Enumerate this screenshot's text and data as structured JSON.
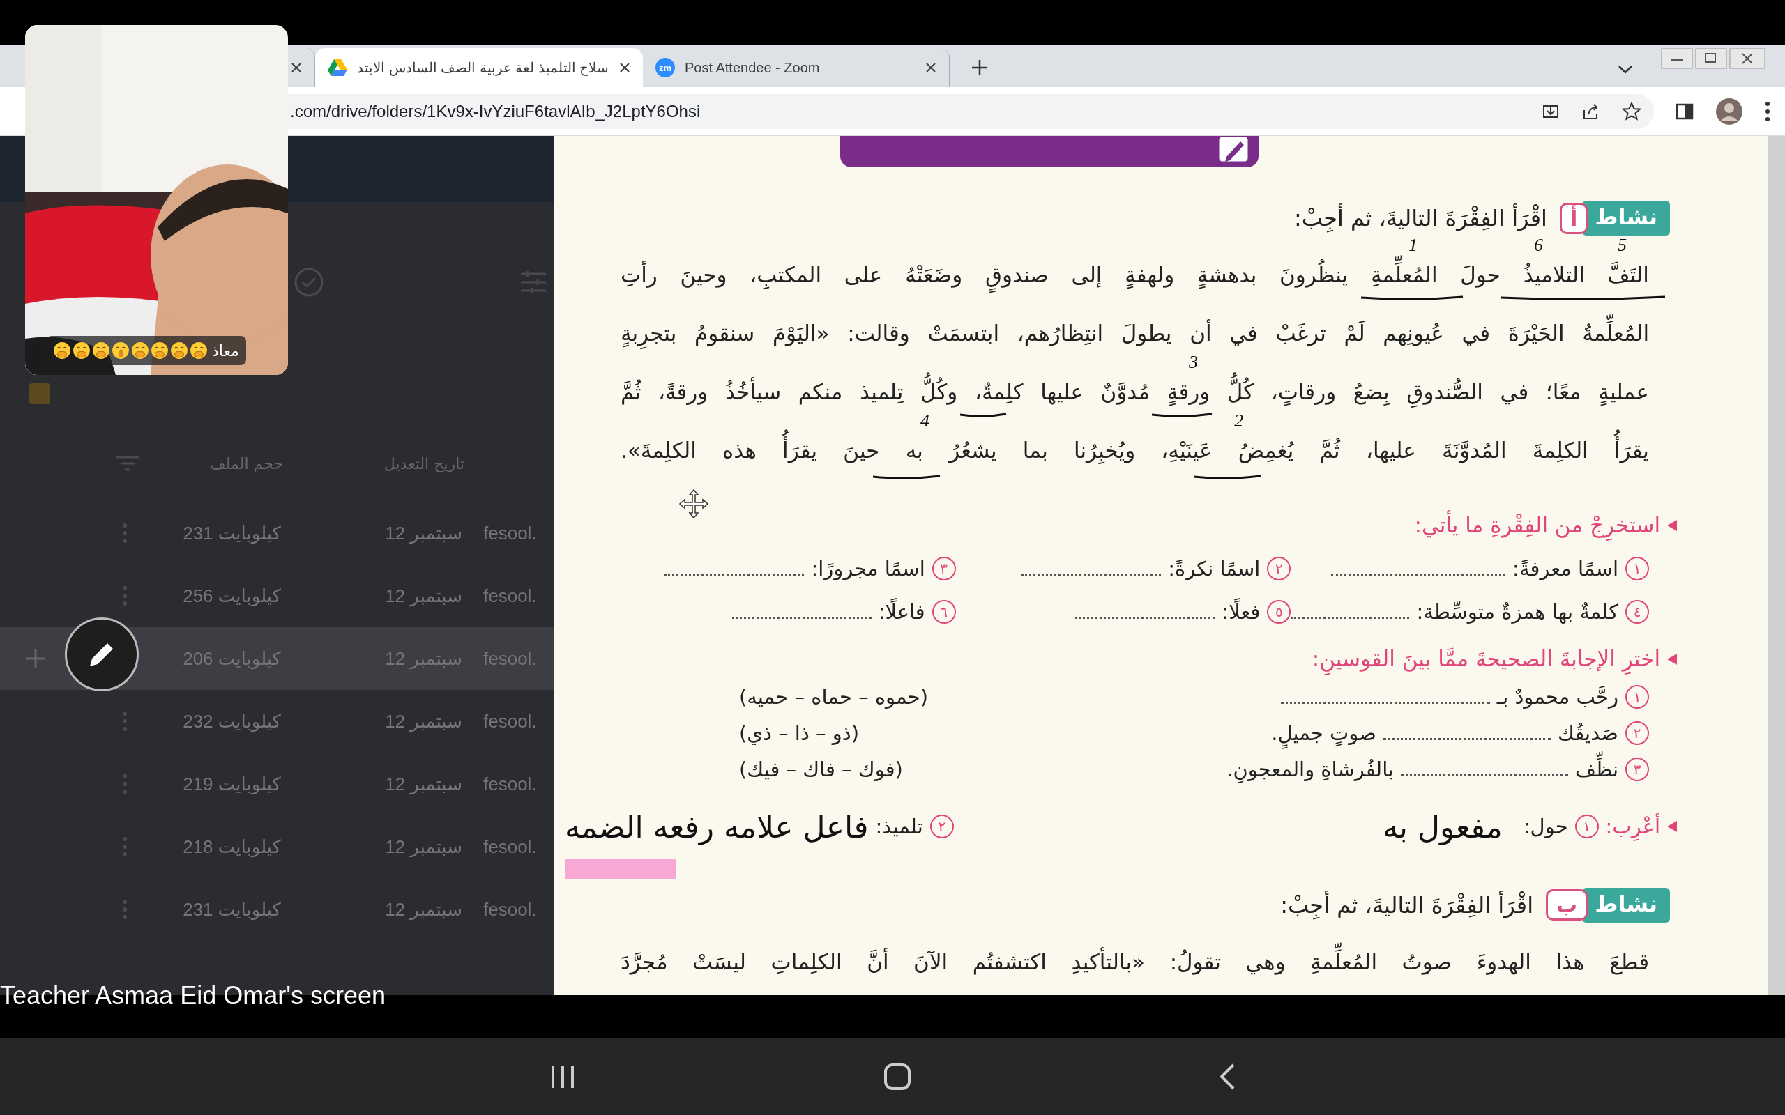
{
  "browser": {
    "first_tab": {
      "kind": "partial",
      "selected": false
    },
    "second_tab": {
      "kind": "drive",
      "title": "سلاح التلميذ لغة عربية الصف السادس الابتد",
      "selected": true
    },
    "third_tab": {
      "kind": "zoom",
      "favicon": "zm",
      "title": "Post Attendee - Zoom",
      "selected": false
    },
    "address": ".com/drive/folders/1Kv9x-IvYziuF6tavlAIb_J2LptY6Ohsi"
  },
  "drive": {
    "columns": [
      "تاريخ التعديل",
      "حجم الملف"
    ],
    "files": [
      {
        "name": "fesool.",
        "modified": "12 سبتمبر",
        "size": "231 كيلوبايت",
        "selected": false
      },
      {
        "name": "fesool.",
        "modified": "12 سبتمبر",
        "size": "256 كيلوبايت",
        "selected": false
      },
      {
        "name": "fesool.",
        "modified": "12 سبتمبر",
        "size": "206 كيلوبايت",
        "selected": true
      },
      {
        "name": "fesool.",
        "modified": "12 سبتمبر",
        "size": "232 كيلوبايت",
        "selected": false
      },
      {
        "name": "fesool.",
        "modified": "12 سبتمبر",
        "size": "219 كيلوبايت",
        "selected": false
      },
      {
        "name": "fesool.",
        "modified": "12 سبتمبر",
        "size": "218 كيلوبايت",
        "selected": false
      },
      {
        "name": "fesool.",
        "modified": "12 سبتمبر",
        "size": "231 كيلوبايت",
        "selected": false
      }
    ]
  },
  "video_tile": {
    "name": "معاذ",
    "reactions": [
      {
        "kind": "hand-over-mouth"
      },
      {
        "kind": "hand-over-mouth"
      },
      {
        "kind": "hand-over-mouth"
      },
      {
        "kind": "shush"
      },
      {
        "kind": "yawn"
      },
      {
        "kind": "yawn"
      },
      {
        "kind": "yawn"
      },
      {
        "kind": "yawn"
      }
    ]
  },
  "document": {
    "activity_a": {
      "badge": "نشاط",
      "letter": "أ",
      "instruction": "اقْرَأ الفِقْرَةَ التاليةَ، ثم أجِبْ:",
      "lines": [
        "التَفَّ التلاميذُ حولَ المُعلِّمةِ ينظُرونَ بدهشةٍ ولهفةٍ إلى صندوقٍ وضَعَتْهُ على المكتبِ، وحينَ رأتِ",
        "المُعلِّمةُ الحَيْرَةَ في عُيونِهم لَمْ ترغَبْ في أن يطولَ انتِظارُهم، ابتسمَتْ وقالت: «اليَوْمَ سنقومُ بتجرِبةٍ",
        "عمليةٍ معًا؛ في الصُّندوقِ بِضعُ ورقاتٍ، كُلُّ ورقةٍ مُدوَّنٌ عليها كلِمةٌ، وكُلُّ تِلميذ منكم سيأخُذُ ورقةً، ثُمَّ",
        "يقرَأُ الكلِمةَ المُدوَّنَةَ عليها، ثُمَّ يُغمِضُ عَينَيْهِ، ويُخبِرُنا بما يشعُرُ به حينَ يقرَأُ هذه الكلِمةَ»."
      ]
    },
    "ink_numbers": [
      "5",
      "6",
      "1",
      "3",
      "2",
      "4"
    ],
    "extract": {
      "heading": "استخرِجْ من الفِقْرةِ ما يأتي:",
      "items": [
        {
          "number": "١",
          "label": "اسمًا معرفةً:"
        },
        {
          "number": "٢",
          "label": "اسمًا نكرةً:"
        },
        {
          "number": "٣",
          "label": "اسمًا مجرورًا:"
        },
        {
          "number": "٤",
          "label": "كلمةٌ بها همزةٌ متوسِّطة:"
        },
        {
          "number": "٥",
          "label": "فعلًا:"
        },
        {
          "number": "٦",
          "label": "فاعلًا:"
        }
      ]
    },
    "choose": {
      "heading": "اخترِ الإجابةَ الصحيحةَ ممَّا بينَ القوسينِ:",
      "items": [
        {
          "number": "١",
          "before": "رحَّب محمودٌ بـ",
          "options": "(حموه – حماه – حميه)"
        },
        {
          "number": "٢",
          "before": "صَديقُك",
          "after": "صوتٍ جميلٍ.",
          "options": "(ذو – ذا – ذي)"
        },
        {
          "number": "٣",
          "before": "نظِّف",
          "after": "بالفُرشاةِ والمعجونِ.",
          "options": "(فوك – فاك – فيك)"
        }
      ]
    },
    "parse": {
      "heading": "أعْرِب:",
      "items": [
        {
          "number": "١",
          "word": "حول:",
          "answer": "مفعول به"
        },
        {
          "number": "٢",
          "word": "تلميذ:",
          "answer": "فاعل علامه رفعه الضمه"
        }
      ]
    },
    "activity_b": {
      "badge": "نشاط",
      "letter": "ب",
      "instruction": "اقْرَأ الفِقْرَةَ التاليةَ، ثم أجِبْ:",
      "lines": [
        "قطعَ هذا الهدوءَ صوتُ المُعلِّمةِ وهي تقولُ: «بالتأكيدِ اكتشفتُم الآنَ أنَّ الكلِماتِ ليسَتْ مُجرَّدَ"
      ]
    }
  },
  "share_label": "Teacher Asmaa Eid Omar's screen"
}
